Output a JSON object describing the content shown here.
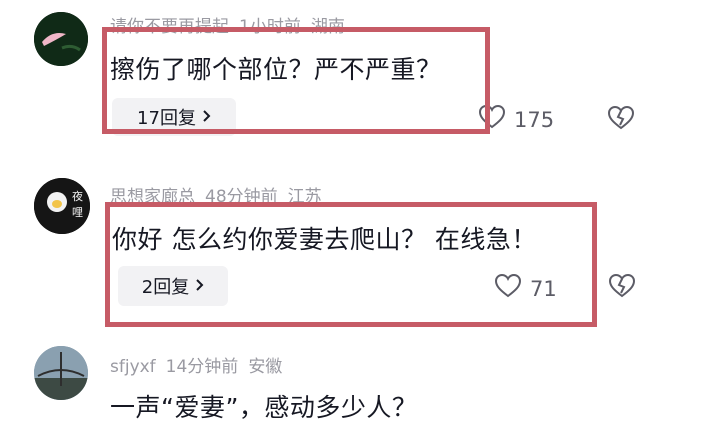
{
  "comments": [
    {
      "meta": {
        "user": "请你不要再提起",
        "time": "1小时前",
        "location": "湖南"
      },
      "text": "擦伤了哪个部位？严不严重？",
      "reply": "17回复",
      "likes": "175"
    },
    {
      "meta": {
        "user": "思想家廊总",
        "time": "48分钟前",
        "location": "江苏"
      },
      "text": "你好 怎么约你爱妻去爬山？ 在线急！",
      "reply": "2回复",
      "likes": "71"
    },
    {
      "meta": {
        "user": "sfjyxf",
        "time": "14分钟前",
        "location": "安徽"
      },
      "text": "一声“爱妻”，感动多少人？"
    }
  ],
  "icons": {
    "like": "heart-outline-icon",
    "dislike": "broken-heart-icon",
    "chevron": "chevron-right-icon"
  },
  "colors": {
    "highlight": "#c65b66",
    "meta": "#9a9aa2",
    "text": "#161823"
  }
}
